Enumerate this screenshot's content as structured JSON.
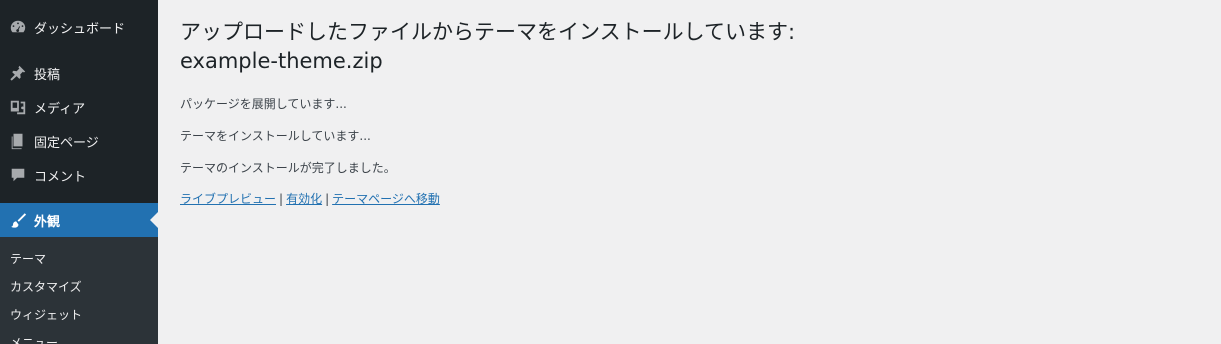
{
  "sidebar": {
    "items": [
      {
        "label": "ダッシュボード",
        "icon": "dashboard-icon"
      },
      {
        "label": "投稿",
        "icon": "pin-icon"
      },
      {
        "label": "メディア",
        "icon": "media-icon"
      },
      {
        "label": "固定ページ",
        "icon": "page-icon"
      },
      {
        "label": "コメント",
        "icon": "comment-icon"
      },
      {
        "label": "外観",
        "icon": "appearance-brush-icon"
      }
    ],
    "submenu": [
      "テーマ",
      "カスタマイズ",
      "ウィジェット",
      "メニュー"
    ]
  },
  "main": {
    "title_line1": "アップロードしたファイルからテーマをインストールしています:",
    "title_line2": "example-theme.zip",
    "messages": [
      "パッケージを展開しています...",
      "テーマをインストールしています...",
      "テーマのインストールが完了しました。"
    ],
    "links": {
      "live_preview": "ライブプレビュー",
      "sep1": "|",
      "activate": "有効化",
      "sep2": "|",
      "themes_page": "テーマページへ移動"
    }
  },
  "colors": {
    "sidebar_bg": "#1d2327",
    "submenu_bg": "#2c3338",
    "accent": "#2271b1",
    "page_bg": "#f0f0f1"
  }
}
